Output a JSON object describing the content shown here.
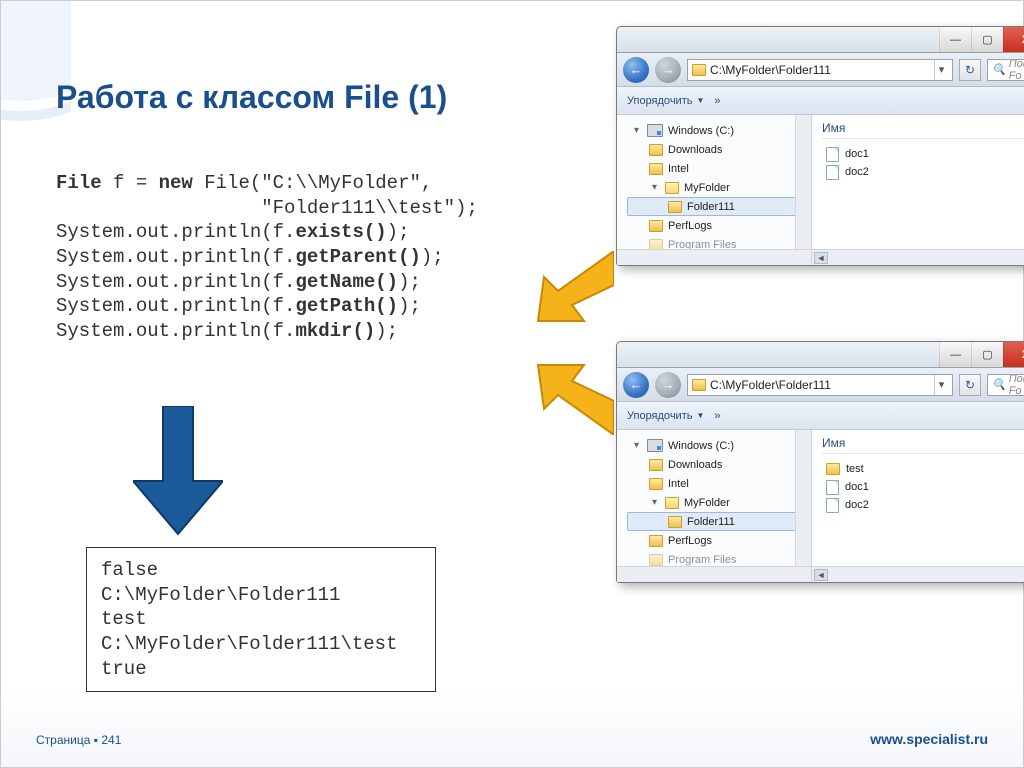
{
  "title": "Работа с классом File (1)",
  "code": {
    "l1a": "File",
    "l1b": " f = ",
    "l1c": "new",
    "l1d": " File(\"C:\\\\MyFolder\",",
    "l2": "                  \"Folder111\\\\test\");",
    "l3a": "System.out.println(f.",
    "l3b": "exists()",
    "l3c": ");",
    "l4a": "System.out.println(f.",
    "l4b": "getParent()",
    "l4c": ");",
    "l5a": "System.out.println(f.",
    "l5b": "getName()",
    "l5c": ");",
    "l6a": "System.out.println(f.",
    "l6b": "getPath()",
    "l5c2": ");",
    "l7a": "System.out.println(f.",
    "l7b": "mkdir()",
    "l7c": ");"
  },
  "output": "false\nC:\\MyFolder\\Folder111\ntest\nC:\\MyFolder\\Folder111\\test\ntrue",
  "footer": {
    "label": "Страница",
    "sq": "▪",
    "num": "241"
  },
  "url": "www.specialist.ru",
  "explorer1": {
    "path": "C:\\MyFolder\\Folder111",
    "search": "Поиск: Fo",
    "organize": "Упорядочить",
    "more": "»",
    "paneHeader": "Имя",
    "tree": {
      "drive": "Windows (C:)",
      "downloads": "Downloads",
      "intel": "Intel",
      "myfolder": "MyFolder",
      "folder111": "Folder111",
      "perflogs": "PerfLogs",
      "extra": "Program Files"
    },
    "files": {
      "f1": "doc1",
      "f2": "doc2"
    }
  },
  "explorer2": {
    "path": "C:\\MyFolder\\Folder111",
    "search": "Поиск: Fo",
    "organize": "Упорядочить",
    "more": "»",
    "paneHeader": "Имя",
    "tree": {
      "drive": "Windows (C:)",
      "downloads": "Downloads",
      "intel": "Intel",
      "myfolder": "MyFolder",
      "folder111": "Folder111",
      "perflogs": "PerfLogs",
      "extra": "Program Files"
    },
    "files": {
      "f1": "test",
      "f2": "doc1",
      "f3": "doc2"
    }
  },
  "win": {
    "min": "—",
    "max": "▢",
    "close": "X"
  }
}
